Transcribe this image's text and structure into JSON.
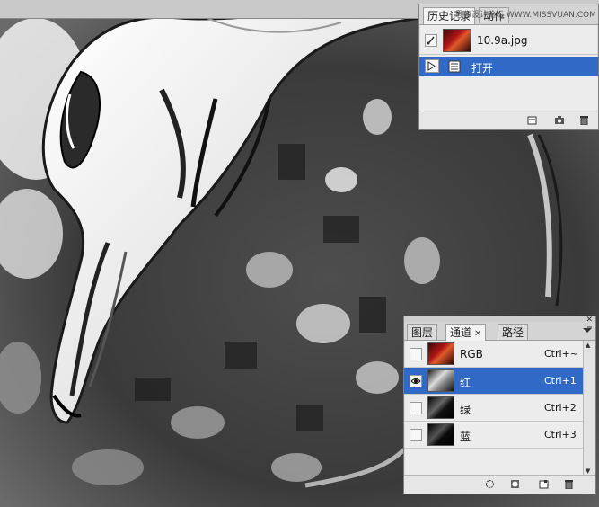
{
  "history_panel": {
    "tabs": [
      {
        "label": "历史记录",
        "active": true
      },
      {
        "label": "动作",
        "active": false
      }
    ],
    "snapshot": {
      "name": "10.9a.jpg"
    },
    "steps": [
      {
        "label": "打开",
        "selected": true
      }
    ],
    "footer_icons": [
      "new-document-from-state-icon",
      "new-snapshot-icon",
      "trash-icon"
    ]
  },
  "channels_panel": {
    "tabs": [
      {
        "label": "图层",
        "active": false
      },
      {
        "label": "通道",
        "active": true,
        "closable": true
      },
      {
        "label": "路径",
        "active": false
      }
    ],
    "channels": [
      {
        "name": "RGB",
        "shortcut": "Ctrl+~",
        "visible": false,
        "selected": false
      },
      {
        "name": "红",
        "shortcut": "Ctrl+1",
        "visible": true,
        "selected": true
      },
      {
        "name": "绿",
        "shortcut": "Ctrl+2",
        "visible": false,
        "selected": false
      },
      {
        "name": "蓝",
        "shortcut": "Ctrl+3",
        "visible": false,
        "selected": false
      }
    ],
    "footer_icons": [
      "load-selection-icon",
      "save-selection-icon",
      "new-channel-icon",
      "trash-icon"
    ]
  },
  "watermark": "思缘设计论坛 WWW.MISSVUAN.COM",
  "colors": {
    "selection": "#3169c6",
    "panel_bg": "#ececec"
  }
}
